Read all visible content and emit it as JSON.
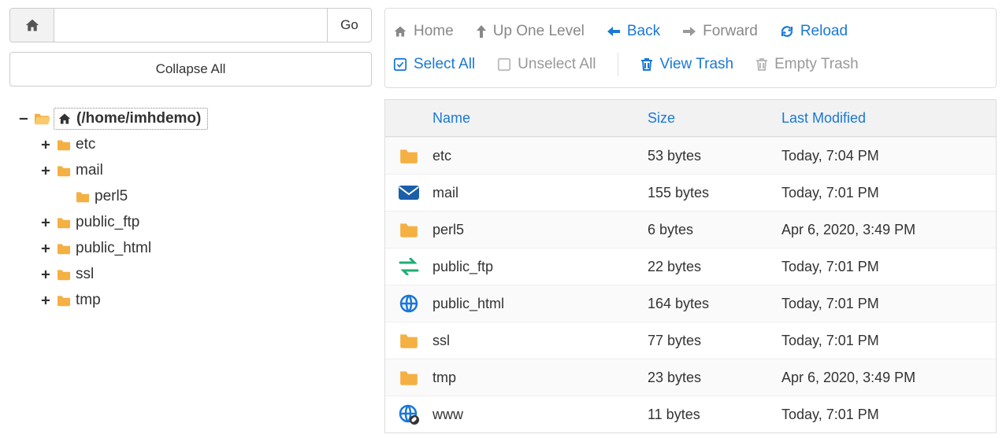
{
  "sidebar": {
    "path_value": "",
    "go_label": "Go",
    "collapse_label": "Collapse All",
    "root_label": "(/home/imhdemo)",
    "root_toggle": "−",
    "items": [
      {
        "toggle": "+",
        "label": "etc",
        "depth": 1
      },
      {
        "toggle": "+",
        "label": "mail",
        "depth": 1
      },
      {
        "toggle": "",
        "label": "perl5",
        "depth": 2
      },
      {
        "toggle": "+",
        "label": "public_ftp",
        "depth": 1
      },
      {
        "toggle": "+",
        "label": "public_html",
        "depth": 1
      },
      {
        "toggle": "+",
        "label": "ssl",
        "depth": 1
      },
      {
        "toggle": "+",
        "label": "tmp",
        "depth": 1
      }
    ]
  },
  "toolbar": {
    "row1": {
      "home": "Home",
      "up": "Up One Level",
      "back": "Back",
      "forward": "Forward",
      "reload": "Reload"
    },
    "row2": {
      "select_all": "Select All",
      "unselect_all": "Unselect All",
      "view_trash": "View Trash",
      "empty_trash": "Empty Trash"
    }
  },
  "table": {
    "header": {
      "name": "Name",
      "size": "Size",
      "modified": "Last Modified"
    },
    "rows": [
      {
        "icon": "folder",
        "name": "etc",
        "size": "53 bytes",
        "modified": "Today, 7:04 PM"
      },
      {
        "icon": "mail",
        "name": "mail",
        "size": "155 bytes",
        "modified": "Today, 7:01 PM"
      },
      {
        "icon": "folder",
        "name": "perl5",
        "size": "6 bytes",
        "modified": "Apr 6, 2020, 3:49 PM"
      },
      {
        "icon": "transfer",
        "name": "public_ftp",
        "size": "22 bytes",
        "modified": "Today, 7:01 PM"
      },
      {
        "icon": "globe",
        "name": "public_html",
        "size": "164 bytes",
        "modified": "Today, 7:01 PM"
      },
      {
        "icon": "folder",
        "name": "ssl",
        "size": "77 bytes",
        "modified": "Today, 7:01 PM"
      },
      {
        "icon": "folder",
        "name": "tmp",
        "size": "23 bytes",
        "modified": "Apr 6, 2020, 3:49 PM"
      },
      {
        "icon": "globe-link",
        "name": "www",
        "size": "11 bytes",
        "modified": "Today, 7:01 PM"
      }
    ]
  }
}
